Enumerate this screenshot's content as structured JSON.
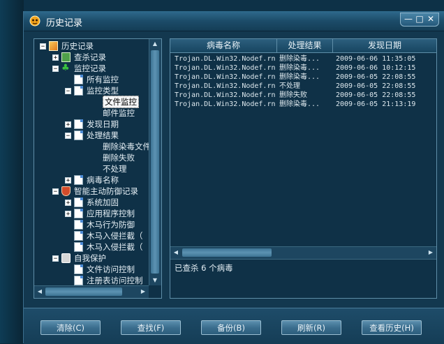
{
  "window": {
    "title": "历史记录",
    "controls": {
      "minimize": "—",
      "maximize": "□",
      "close": "✕"
    }
  },
  "tree": {
    "nodes": [
      {
        "label": "历史记录",
        "expander": "−",
        "icon": "book-icon",
        "level": 0
      },
      {
        "label": "查杀记录",
        "expander": "+",
        "icon": "chart-icon",
        "level": 1
      },
      {
        "label": "监控记录",
        "expander": "−",
        "icon": "palm-tree-icon",
        "level": 1
      },
      {
        "label": "所有监控",
        "expander": "",
        "icon": "document-icon",
        "level": 2
      },
      {
        "label": "监控类型",
        "expander": "−",
        "icon": "document-icon",
        "level": 2
      },
      {
        "label": "文件监控",
        "expander": "",
        "icon": "",
        "level": 3,
        "selected": true
      },
      {
        "label": "邮件监控",
        "expander": "",
        "icon": "",
        "level": 3
      },
      {
        "label": "发现日期",
        "expander": "+",
        "icon": "document-icon",
        "level": 2
      },
      {
        "label": "处理结果",
        "expander": "−",
        "icon": "document-icon",
        "level": 2
      },
      {
        "label": "删除染毒文件",
        "expander": "",
        "icon": "",
        "level": 3
      },
      {
        "label": "删除失败",
        "expander": "",
        "icon": "",
        "level": 3
      },
      {
        "label": "不处理",
        "expander": "",
        "icon": "",
        "level": 3
      },
      {
        "label": "病毒名称",
        "expander": "+",
        "icon": "document-icon",
        "level": 2
      },
      {
        "label": "智能主动防御记录",
        "expander": "−",
        "icon": "shield-icon",
        "level": 1
      },
      {
        "label": "系统加固",
        "expander": "+",
        "icon": "document-icon",
        "level": 2
      },
      {
        "label": "应用程序控制",
        "expander": "+",
        "icon": "document-icon",
        "level": 2
      },
      {
        "label": "木马行为防御",
        "expander": "",
        "icon": "document-icon",
        "level": 2
      },
      {
        "label": "木马入侵拦截（",
        "expander": "",
        "icon": "document-icon",
        "level": 2
      },
      {
        "label": "木马入侵拦截（",
        "expander": "",
        "icon": "document-icon",
        "level": 2
      },
      {
        "label": "自我保护",
        "expander": "−",
        "icon": "lock-icon",
        "level": 1
      },
      {
        "label": "文件访问控制",
        "expander": "",
        "icon": "document-icon",
        "level": 2
      },
      {
        "label": "注册表访问控制",
        "expander": "",
        "icon": "document-icon",
        "level": 2
      }
    ]
  },
  "list": {
    "headers": [
      "病毒名称",
      "处理结果",
      "发现日期"
    ],
    "rows": [
      [
        "Trojan.DL.Win32.Nodef.rn",
        "删除染毒...",
        "2009-06-06 11:35:05"
      ],
      [
        "Trojan.DL.Win32.Nodef.rn",
        "删除染毒...",
        "2009-06-06 10:12:15"
      ],
      [
        "Trojan.DL.Win32.Nodef.rn",
        "删除染毒...",
        "2009-06-05 22:08:55"
      ],
      [
        "Trojan.DL.Win32.Nodef.rn",
        "不处理",
        "2009-06-05 22:08:55"
      ],
      [
        "Trojan.DL.Win32.Nodef.rn",
        "删除失败",
        "2009-06-05 22:08:55"
      ],
      [
        "Trojan.DL.Win32.Nodef.rn",
        "删除染毒...",
        "2009-06-05 21:13:19"
      ]
    ],
    "status": "已查杀 6 个病毒"
  },
  "buttons": {
    "clear": "清除(C)",
    "find": "查找(F)",
    "backup": "备份(B)",
    "refresh": "刷新(R)",
    "view_history": "查看历史(H)"
  }
}
